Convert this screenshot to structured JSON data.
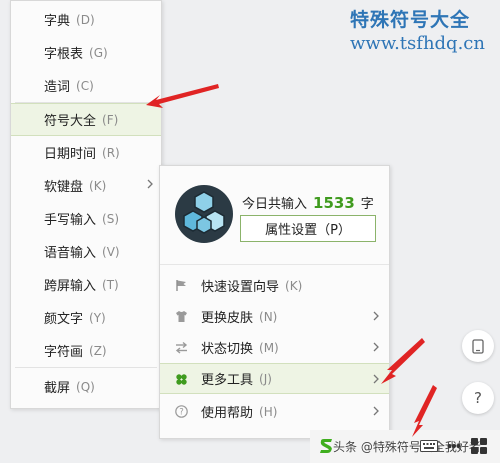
{
  "watermark": {
    "title": "特殊符号大全",
    "url": "www.tsfhdq.cn"
  },
  "left_menu": {
    "items": [
      {
        "label": "字典",
        "shortcut": "(D)"
      },
      {
        "label": "字根表",
        "shortcut": "(G)"
      },
      {
        "label": "造词",
        "shortcut": "(C)"
      },
      {
        "label": "符号大全",
        "shortcut": "(F)",
        "active": true
      },
      {
        "label": "日期时间",
        "shortcut": "(R)"
      },
      {
        "label": "软键盘",
        "shortcut": "(K)",
        "submenu": true
      },
      {
        "label": "手写输入",
        "shortcut": "(S)"
      },
      {
        "label": "语音输入",
        "shortcut": "(V)"
      },
      {
        "label": "跨屏输入",
        "shortcut": "(T)"
      },
      {
        "label": "颜文字",
        "shortcut": "(Y)"
      },
      {
        "label": "字符画",
        "shortcut": "(Z)"
      },
      {
        "label": "截屏",
        "shortcut": "(Q)"
      }
    ]
  },
  "panel": {
    "today_prefix": "今日共输入",
    "today_count": "1533",
    "today_suffix": "字",
    "settings_button": "属性设置（P）",
    "items": [
      {
        "label": "快速设置向导",
        "shortcut": "(K)",
        "icon": "flag-icon"
      },
      {
        "label": "更换皮肤",
        "shortcut": "(N)",
        "icon": "shirt-icon",
        "submenu": true
      },
      {
        "label": "状态切换",
        "shortcut": "(M)",
        "icon": "switch-icon",
        "submenu": true
      },
      {
        "label": "更多工具",
        "shortcut": "(J)",
        "icon": "clover-icon",
        "submenu": true,
        "active": true
      },
      {
        "label": "使用帮助",
        "shortcut": "(H)",
        "icon": "help-icon",
        "submenu": true
      }
    ]
  },
  "side_buttons": {
    "help_label": "?"
  },
  "bottom_bar": {
    "toutiao_text": "头条 @特殊符号大全我好者"
  },
  "colors": {
    "accent_green": "#3f9b1e",
    "active_bg": "#eef4e4",
    "arrow_red": "#e02424",
    "watermark_blue": "#2e75b6"
  }
}
